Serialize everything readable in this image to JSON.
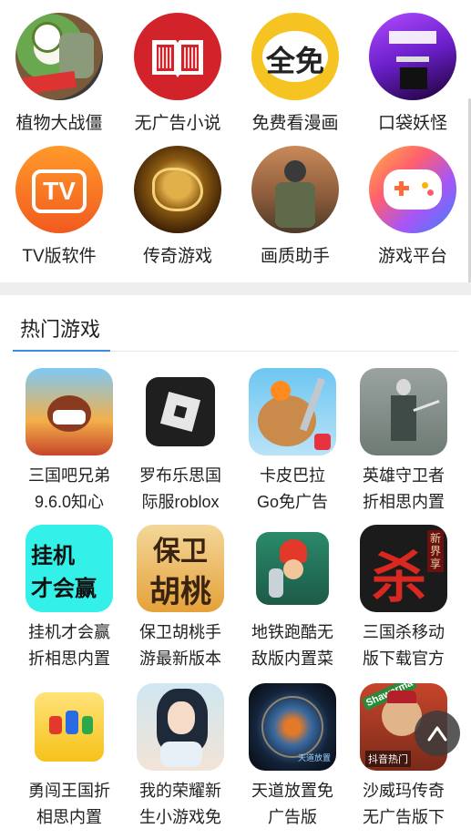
{
  "categories": [
    {
      "label": "植物大战僵",
      "icon": "plants-vs-zombies-icon"
    },
    {
      "label": "无广告小说",
      "icon": "book-icon"
    },
    {
      "label": "免费看漫画",
      "icon": "comic-icon",
      "badge": "全免"
    },
    {
      "label": "口袋妖怪",
      "icon": "pixel-game-icon"
    },
    {
      "label": "TV版软件",
      "icon": "tv-icon",
      "badge": "TV"
    },
    {
      "label": "传奇游戏",
      "icon": "dragon-icon"
    },
    {
      "label": "画质助手",
      "icon": "soldier-icon"
    },
    {
      "label": "游戏平台",
      "icon": "gamepad-icon"
    }
  ],
  "hot_section": {
    "title": "热门游戏"
  },
  "games": [
    {
      "line1": "三国吧兄弟",
      "line2": "9.6.0知心",
      "icon": "warrior-icon"
    },
    {
      "line1": "罗布乐思国",
      "line2": "际服roblox",
      "icon": "roblox-icon"
    },
    {
      "line1": "卡皮巴拉",
      "line2": "Go免广告",
      "icon": "capybara-icon"
    },
    {
      "line1": "英雄守卫者",
      "line2": "折相思内置",
      "icon": "hero-icon"
    },
    {
      "line1": "挂机才会赢",
      "line2": "折相思内置",
      "icon": "idle-text-icon",
      "badge1": "挂机",
      "badge2": "才会赢"
    },
    {
      "line1": "保卫胡桃手",
      "line2": "游最新版本",
      "icon": "hutao-icon",
      "badge1": "保卫",
      "badge2": "胡桃"
    },
    {
      "line1": "地铁跑酷无",
      "line2": "敌版内置菜",
      "icon": "subway-icon"
    },
    {
      "line1": "三国杀移动",
      "line2": "版下载官方",
      "icon": "sanguosha-icon",
      "badge1": "杀",
      "badge2": "新界享"
    },
    {
      "line1": "勇闯王国折",
      "line2": "相思内置",
      "icon": "kingdom-icon"
    },
    {
      "line1": "我的荣耀新",
      "line2": "生小游戏免",
      "icon": "anime-girl-icon"
    },
    {
      "line1": "天道放置免",
      "line2": "广告版",
      "icon": "planet-icon",
      "badge1": "天道放置"
    },
    {
      "line1": "沙威玛传奇",
      "line2": "无广告版下",
      "icon": "shawarma-icon",
      "badge1": "Shawarma",
      "badge2": "抖音热门"
    }
  ],
  "colors": {
    "accent": "#3b8de0",
    "divider": "#eeeeee"
  },
  "fab": {
    "icon": "back-to-top-icon"
  }
}
